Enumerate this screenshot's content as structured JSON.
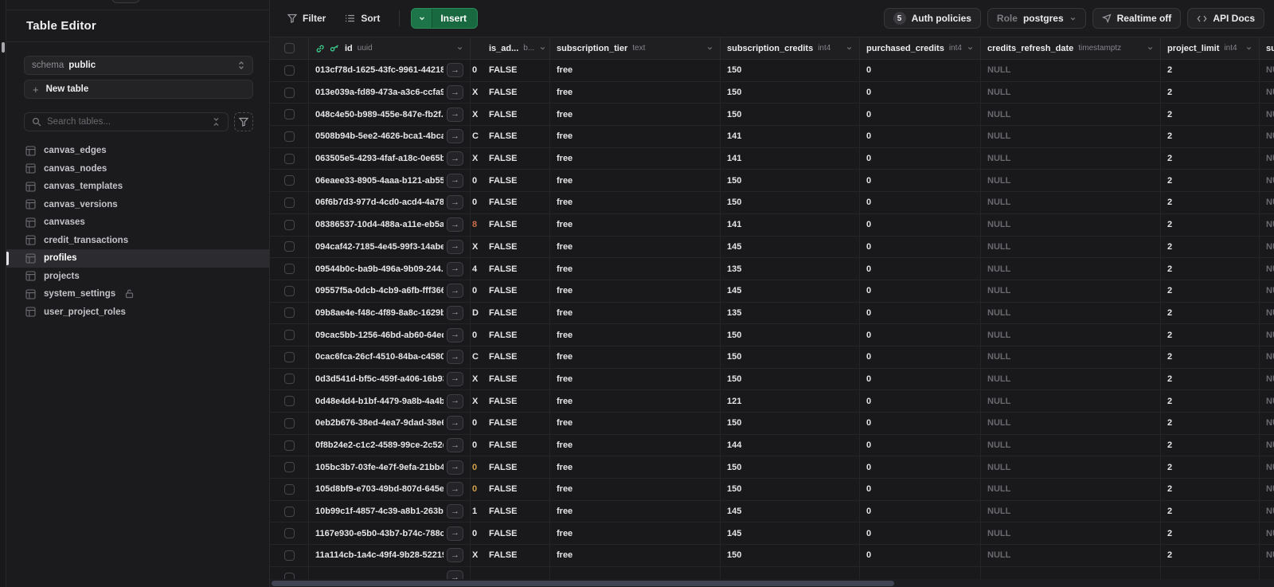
{
  "colors": {
    "brand_green": "#3ecf8e",
    "insert_green": "#18693f",
    "lock_amber": "#b0812c",
    "null_gray": "#69696e"
  },
  "sidebar": {
    "title": "Table Editor",
    "schema_label": "schema",
    "schema_value": "public",
    "new_table_label": "New table",
    "search_placeholder": "Search tables...",
    "tables": [
      {
        "name": "canvas_edges"
      },
      {
        "name": "canvas_nodes"
      },
      {
        "name": "canvas_templates"
      },
      {
        "name": "canvas_versions"
      },
      {
        "name": "canvases"
      },
      {
        "name": "credit_transactions"
      },
      {
        "name": "profiles",
        "selected": true
      },
      {
        "name": "projects"
      },
      {
        "name": "system_settings",
        "locked": true
      },
      {
        "name": "user_project_roles"
      }
    ]
  },
  "toolbar": {
    "filter_label": "Filter",
    "sort_label": "Sort",
    "insert_label": "Insert",
    "auth_count": "5",
    "auth_label": "Auth policies",
    "role_prefix": "Role",
    "role_value": "postgres",
    "realtime_label": "Realtime off",
    "api_docs_label": "API Docs"
  },
  "grid": {
    "columns": [
      {
        "name": "id",
        "type": "uuid"
      },
      {
        "name": "is_ad...",
        "type": "b..."
      },
      {
        "name": "subscription_tier",
        "type": "text"
      },
      {
        "name": "subscription_credits",
        "type": "int4"
      },
      {
        "name": "purchased_credits",
        "type": "int4"
      },
      {
        "name": "credits_refresh_date",
        "type": "timestamptz"
      },
      {
        "name": "project_limit",
        "type": "int4"
      },
      {
        "name": "su",
        "type": ""
      }
    ],
    "rows": [
      {
        "id": "013cf78d-1625-43fc-9961-442189...",
        "frag": "0",
        "is_admin": "FALSE",
        "tier": "free",
        "sub_credits": "150",
        "purchased": "0",
        "refresh": "NULL",
        "limit": "2",
        "last": "NULL"
      },
      {
        "id": "013e039a-fd89-473a-a3c6-ccfa9...",
        "frag": "X",
        "is_admin": "FALSE",
        "tier": "free",
        "sub_credits": "150",
        "purchased": "0",
        "refresh": "NULL",
        "limit": "2",
        "last": "NULL"
      },
      {
        "id": "048c4e50-b989-455e-847e-fb2f...",
        "frag": "X",
        "is_admin": "FALSE",
        "tier": "free",
        "sub_credits": "150",
        "purchased": "0",
        "refresh": "NULL",
        "limit": "2",
        "last": "NULL"
      },
      {
        "id": "0508b94b-5ee2-4626-bca1-4bca...",
        "frag": "C",
        "is_admin": "FALSE",
        "tier": "free",
        "sub_credits": "141",
        "purchased": "0",
        "refresh": "NULL",
        "limit": "2",
        "last": "NULL"
      },
      {
        "id": "063505e5-4293-4faf-a18c-0e65b...",
        "frag": "X",
        "is_admin": "FALSE",
        "tier": "free",
        "sub_credits": "141",
        "purchased": "0",
        "refresh": "NULL",
        "limit": "2",
        "last": "NULL"
      },
      {
        "id": "06eaee33-8905-4aaa-b121-ab552...",
        "frag": "0",
        "is_admin": "FALSE",
        "tier": "free",
        "sub_credits": "150",
        "purchased": "0",
        "refresh": "NULL",
        "limit": "2",
        "last": "NULL"
      },
      {
        "id": "06f6b7d3-977d-4cd0-acd4-4a78...",
        "frag": "0",
        "is_admin": "FALSE",
        "tier": "free",
        "sub_credits": "150",
        "purchased": "0",
        "refresh": "NULL",
        "limit": "2",
        "last": "NULL"
      },
      {
        "id": "08386537-10d4-488a-a11e-eb5a6...",
        "frag": "8",
        "frag_color": "#c96f4a",
        "is_admin": "FALSE",
        "tier": "free",
        "sub_credits": "141",
        "purchased": "0",
        "refresh": "NULL",
        "limit": "2",
        "last": "NULL"
      },
      {
        "id": "094caf42-7185-4e45-99f3-14abee...",
        "frag": "X",
        "is_admin": "FALSE",
        "tier": "free",
        "sub_credits": "145",
        "purchased": "0",
        "refresh": "NULL",
        "limit": "2",
        "last": "NULL"
      },
      {
        "id": "09544b0c-ba9b-496a-9b09-244...",
        "frag": "4",
        "is_admin": "FALSE",
        "tier": "free",
        "sub_credits": "135",
        "purchased": "0",
        "refresh": "NULL",
        "limit": "2",
        "last": "NULL"
      },
      {
        "id": "09557f5a-0dcb-4cb9-a6fb-fff366...",
        "frag": "0",
        "is_admin": "FALSE",
        "tier": "free",
        "sub_credits": "145",
        "purchased": "0",
        "refresh": "NULL",
        "limit": "2",
        "last": "NULL"
      },
      {
        "id": "09b8ae4e-f48c-4f89-8a8c-1629b...",
        "frag": "D",
        "is_admin": "FALSE",
        "tier": "free",
        "sub_credits": "135",
        "purchased": "0",
        "refresh": "NULL",
        "limit": "2",
        "last": "NULL"
      },
      {
        "id": "09cac5bb-1256-46bd-ab60-64ed...",
        "frag": "0",
        "is_admin": "FALSE",
        "tier": "free",
        "sub_credits": "150",
        "purchased": "0",
        "refresh": "NULL",
        "limit": "2",
        "last": "NULL"
      },
      {
        "id": "0cac6fca-26cf-4510-84ba-c4580...",
        "frag": "C",
        "is_admin": "FALSE",
        "tier": "free",
        "sub_credits": "150",
        "purchased": "0",
        "refresh": "NULL",
        "limit": "2",
        "last": "NULL"
      },
      {
        "id": "0d3d541d-bf5c-459f-a406-16b93...",
        "frag": "X",
        "is_admin": "FALSE",
        "tier": "free",
        "sub_credits": "150",
        "purchased": "0",
        "refresh": "NULL",
        "limit": "2",
        "last": "NULL"
      },
      {
        "id": "0d48e4d4-b1bf-4479-9a8b-4a4b...",
        "frag": "X",
        "is_admin": "FALSE",
        "tier": "free",
        "sub_credits": "121",
        "purchased": "0",
        "refresh": "NULL",
        "limit": "2",
        "last": "NULL"
      },
      {
        "id": "0eb2b676-38ed-4ea7-9dad-38e6...",
        "frag": "0",
        "is_admin": "FALSE",
        "tier": "free",
        "sub_credits": "150",
        "purchased": "0",
        "refresh": "NULL",
        "limit": "2",
        "last": "NULL"
      },
      {
        "id": "0f8b24e2-c1c2-4589-99ce-2c52d...",
        "frag": "0",
        "is_admin": "FALSE",
        "tier": "free",
        "sub_credits": "144",
        "purchased": "0",
        "refresh": "NULL",
        "limit": "2",
        "last": "NULL"
      },
      {
        "id": "105bc3b7-03fe-4e7f-9efa-21bb40...",
        "frag": "0",
        "frag_color": "#d2a24a",
        "is_admin": "FALSE",
        "tier": "free",
        "sub_credits": "150",
        "purchased": "0",
        "refresh": "NULL",
        "limit": "2",
        "last": "NULL"
      },
      {
        "id": "105d8bf9-e703-49bd-807d-645e...",
        "frag": "0",
        "frag_color": "#d2a24a",
        "is_admin": "FALSE",
        "tier": "free",
        "sub_credits": "150",
        "purchased": "0",
        "refresh": "NULL",
        "limit": "2",
        "last": "NULL"
      },
      {
        "id": "10b99c1f-4857-4c39-a8b1-263b8...",
        "frag": "1",
        "is_admin": "FALSE",
        "tier": "free",
        "sub_credits": "145",
        "purchased": "0",
        "refresh": "NULL",
        "limit": "2",
        "last": "NULL"
      },
      {
        "id": "1167e930-e5b0-43b7-b74c-788c9...",
        "frag": "0",
        "is_admin": "FALSE",
        "tier": "free",
        "sub_credits": "145",
        "purchased": "0",
        "refresh": "NULL",
        "limit": "2",
        "last": "NULL"
      },
      {
        "id": "11a114cb-1a4c-49f4-9b28-52219ec...",
        "frag": "X",
        "is_admin": "FALSE",
        "tier": "free",
        "sub_credits": "150",
        "purchased": "0",
        "refresh": "NULL",
        "limit": "2",
        "last": "NULL"
      },
      {
        "id": "",
        "frag": "",
        "is_admin": "",
        "tier": "",
        "sub_credits": "",
        "purchased": "",
        "refresh": "",
        "limit": "",
        "last": ""
      }
    ]
  }
}
